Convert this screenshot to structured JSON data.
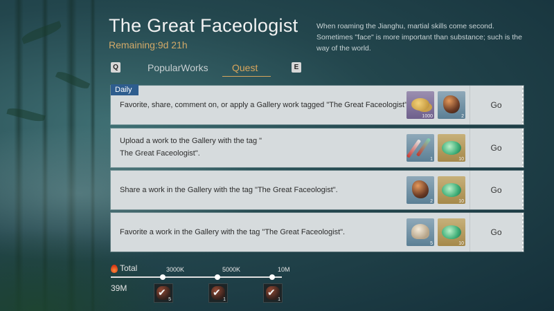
{
  "header": {
    "title": "The Great Faceologist",
    "remaining": "Remaining:9d 21h",
    "description": "When roaming the Jianghu, martial skills come second. Sometimes \"face\" is more important than substance; such is the way of the world."
  },
  "tabs": {
    "prev_key": "Q",
    "next_key": "E",
    "items": [
      {
        "label": "PopularWorks",
        "active": false
      },
      {
        "label": "Quest",
        "active": true
      }
    ]
  },
  "quests": [
    {
      "badge": "Daily",
      "text": "Favorite, share, comment on, or apply a Gallery work tagged \"The Great Faceologist\".",
      "rewards": [
        {
          "icon": "coin-icon",
          "qty": "1000",
          "tint": "purple"
        },
        {
          "icon": "ore-icon",
          "qty": "2",
          "tint": "blue"
        }
      ],
      "action": "Go"
    },
    {
      "badge": "",
      "text_line1": "Upload a work to the Gallery with the tag \"",
      "text_line2": "The Great Faceologist\".",
      "rewards": [
        {
          "icon": "brush-icon",
          "qty": "1",
          "tint": "blue"
        },
        {
          "icon": "jade-icon",
          "qty": "10",
          "tint": "gold"
        }
      ],
      "action": "Go"
    },
    {
      "badge": "",
      "text": "Share a work in the Gallery with the tag \"The Great Faceologist\".",
      "rewards": [
        {
          "icon": "ore-icon",
          "qty": "2",
          "tint": "blue"
        },
        {
          "icon": "jade-icon",
          "qty": "10",
          "tint": "gold"
        }
      ],
      "action": "Go"
    },
    {
      "badge": "",
      "text": "Favorite a work in the Gallery with the tag \"The Great Faceologist\".",
      "rewards": [
        {
          "icon": "mushroom-icon",
          "qty": "5",
          "tint": "blue"
        },
        {
          "icon": "jade-icon",
          "qty": "10",
          "tint": "gold"
        }
      ],
      "action": "Go"
    }
  ],
  "total": {
    "label": "Total",
    "value": "39M",
    "milestones": [
      {
        "label": "3000K",
        "qty": "5",
        "claimed": true
      },
      {
        "label": "5000K",
        "qty": "1",
        "claimed": true
      },
      {
        "label": "10M",
        "qty": "1",
        "claimed": true
      }
    ]
  },
  "colors": {
    "accent": "#d9a65c",
    "daily_badge": "#2e5d8e",
    "card_bg": "#d6dbdd"
  }
}
